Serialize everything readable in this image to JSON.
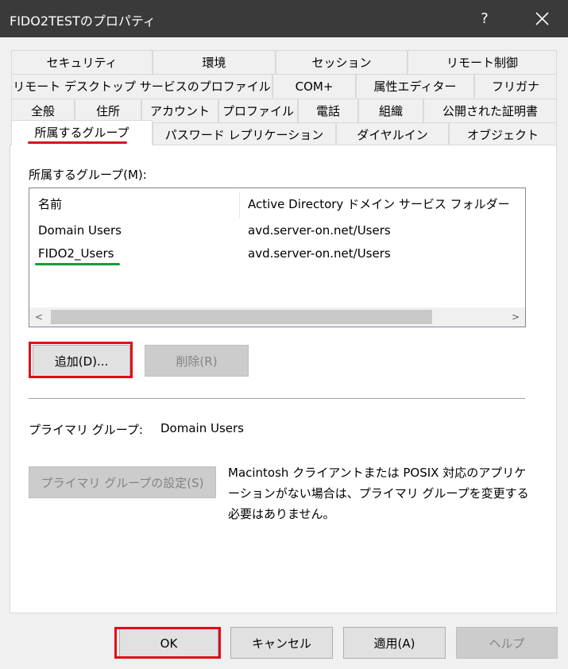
{
  "window": {
    "title": "FIDO2TESTのプロパティ",
    "help_label": "?"
  },
  "tabs": {
    "row1": [
      "セキュリティ",
      "環境",
      "セッション",
      "リモート制御"
    ],
    "row2": [
      "リモート デスクトップ サービスのプロファイル",
      "COM+",
      "属性エディター",
      "フリガナ"
    ],
    "row3": [
      "全般",
      "住所",
      "アカウント",
      "プロファイル",
      "電話",
      "組織",
      "公開された証明書"
    ],
    "row4": [
      "所属するグループ",
      "パスワード レプリケーション",
      "ダイヤルイン",
      "オブジェクト"
    ]
  },
  "member_of": {
    "label": "所属するグループ(M):",
    "columns": [
      "名前",
      "Active Directory ドメイン サービス フォルダー"
    ],
    "rows": [
      {
        "name": "Domain Users",
        "folder": "avd.server-on.net/Users"
      },
      {
        "name": "FIDO2_Users",
        "folder": "avd.server-on.net/Users"
      }
    ],
    "scroll_left": "<",
    "scroll_right": ">",
    "add_label": "追加(D)...",
    "remove_label": "削除(R)"
  },
  "primary_group": {
    "label": "プライマリ グループ:",
    "value": "Domain Users",
    "set_label": "プライマリ グループの設定(S)",
    "note": "Macintosh クライアントまたは POSIX 対応のアプリケーションがない場合は、プライマリ グループを変更する必要はありません。"
  },
  "footer": {
    "ok_label": "OK",
    "cancel_label": "キャンセル",
    "apply_label": "適用(A)",
    "help_label": "ヘルプ"
  },
  "colors": {
    "titlebar": "#3a3a3a",
    "highlight_red": "#e00d1a",
    "underline_green": "#1a9a3a",
    "dialog_bg": "#f0f0f0"
  }
}
